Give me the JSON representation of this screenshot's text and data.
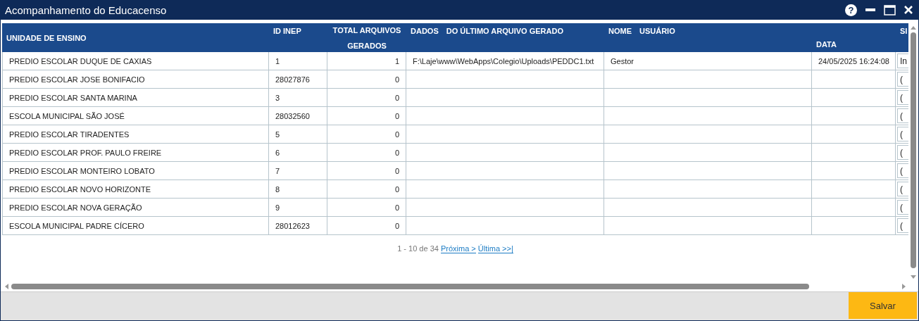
{
  "window": {
    "title": "Acompanhamento do Educacenso",
    "controls": [
      {
        "kind": "help",
        "label": "?"
      },
      {
        "kind": "minimize"
      },
      {
        "kind": "maximize"
      },
      {
        "kind": "close"
      }
    ]
  },
  "table": {
    "columns": [
      {
        "texts": [
          "UNIDADE DE ENSINO"
        ]
      },
      {
        "texts": [
          "ID INEP"
        ]
      },
      {
        "texts": [
          "TOTAL ARQUIVOS",
          "GERADOS"
        ]
      },
      {
        "texts": [
          "DADOS",
          "DO ÚLTIMO ARQUIVO GERADO"
        ]
      },
      {
        "texts": [
          "NOME",
          "USUÁRIO"
        ]
      },
      {
        "texts": [
          "DATA"
        ]
      },
      {
        "texts": [
          "SI"
        ]
      }
    ],
    "rows": [
      [
        "PREDIO ESCOLAR DUQUE DE CAXIAS",
        "1",
        "1",
        "F:\\Laje\\www\\WebApps\\Colegio\\Uploads\\PEDDC1.txt",
        "Gestor",
        "24/05/2025 16:24:08",
        "In"
      ],
      [
        "PREDIO ESCOLAR JOSE BONIFACIO",
        "28027876",
        "0",
        "",
        "",
        "",
        "("
      ],
      [
        "PREDIO ESCOLAR SANTA MARINA",
        "3",
        "0",
        "",
        "",
        "",
        "("
      ],
      [
        "ESCOLA MUNICIPAL SÃO JOSÉ",
        "28032560",
        "0",
        "",
        "",
        "",
        "("
      ],
      [
        "PREDIO ESCOLAR TIRADENTES",
        "5",
        "0",
        "",
        "",
        "",
        "("
      ],
      [
        "PREDIO ESCOLAR PROF. PAULO FREIRE",
        "6",
        "0",
        "",
        "",
        "",
        "("
      ],
      [
        "PREDIO ESCOLAR MONTEIRO LOBATO",
        "7",
        "0",
        "",
        "",
        "",
        "("
      ],
      [
        "PREDIO ESCOLAR NOVO HORIZONTE",
        "8",
        "0",
        "",
        "",
        "",
        "("
      ],
      [
        "PREDIO ESCOLAR NOVA GERAÇÃO",
        "9",
        "0",
        "",
        "",
        "",
        "("
      ],
      [
        "ESCOLA MUNICIPAL PADRE CÍCERO",
        "28012623",
        "0",
        "",
        "",
        "",
        "("
      ]
    ]
  },
  "pager": {
    "summary": "1 - 10 de 34",
    "links": [
      "Próxima >",
      "Última >>|"
    ]
  },
  "footer": {
    "button": "Salvar"
  }
}
